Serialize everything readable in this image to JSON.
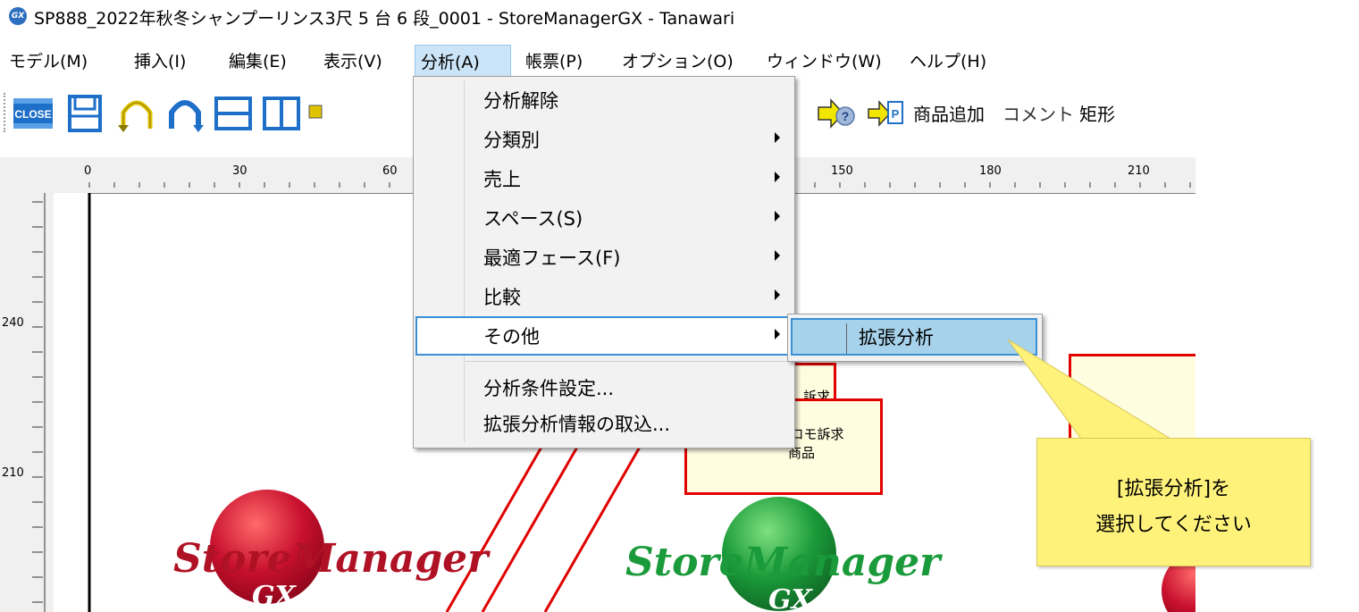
{
  "window": {
    "icon_text": "GX",
    "title": "SP888_2022年秋冬シャンプーリンス3尺 5 台 6 段_0001 - StoreManagerGX - Tanawari"
  },
  "menubar": {
    "items": [
      {
        "label": "モデル(M)"
      },
      {
        "label": "挿入(I)"
      },
      {
        "label": "編集(E)"
      },
      {
        "label": "表示(V)"
      },
      {
        "label": "分析(A)"
      },
      {
        "label": "帳票(P)"
      },
      {
        "label": "オプション(O)"
      },
      {
        "label": "ウィンドウ(W)"
      },
      {
        "label": "ヘルプ(H)"
      }
    ]
  },
  "toolbar": {
    "close_label": "CLOSE",
    "add_product_label": "商品追加",
    "comment_label": "コメント",
    "rect_label": "矩形"
  },
  "ruler": {
    "top_labels": [
      "0",
      "30",
      "60",
      "150",
      "180",
      "210"
    ],
    "left_labels": [
      "240",
      "210"
    ]
  },
  "analysis_menu": {
    "items": [
      {
        "label": "分析解除"
      },
      {
        "label": "分類別"
      },
      {
        "label": "売上"
      },
      {
        "label": "スペース(S)"
      },
      {
        "label": "最適フェース(F)"
      },
      {
        "label": "比較"
      },
      {
        "label": "その他"
      },
      {
        "label": "分析条件設定..."
      },
      {
        "label": "拡張分析情報の取込..."
      }
    ]
  },
  "other_submenu": {
    "items": [
      {
        "label": "拡張分析"
      }
    ]
  },
  "callout": {
    "line1": "[拡張分析]を",
    "line2": "選択してください"
  },
  "canvas": {
    "pop1_text": "訴求",
    "pop2_line1": "プロモ訴求",
    "pop2_line2": "商品",
    "logo1_main": "StoreManager",
    "logo1_sub": "GX",
    "logo2_main": "StoreManager",
    "logo2_sub": "GX"
  },
  "colors": {
    "menu_highlight": "#cce4f7",
    "submenu_highlight": "#a7d2eb",
    "selection_border": "#3b8fd4",
    "callout_bg": "#fff27a",
    "pop_border": "#e00000",
    "logo_red": "#c8102e",
    "logo_green": "#1a9a3a"
  }
}
